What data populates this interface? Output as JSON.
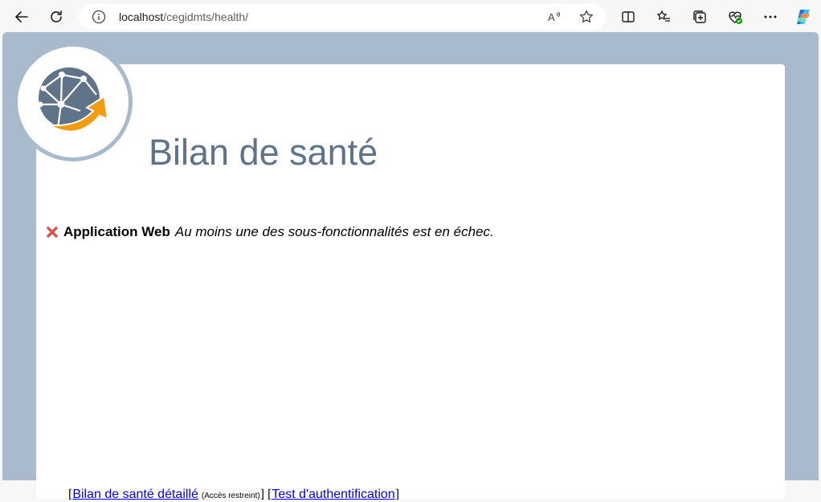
{
  "browser": {
    "url_host": "localhost",
    "url_path": "/cegidmts/health/"
  },
  "page": {
    "title": "Bilan de santé",
    "status": {
      "app_name": "Application Web",
      "message": "Au moins une des sous-fonctionnalités est en échec.",
      "state_color": "#d9534f"
    },
    "footer": {
      "open_bracket_1": "[",
      "link_detailed": "Bilan de santé détaillé",
      "restricted_note": "(Accès restreint)",
      "close_bracket_1": "]",
      "open_bracket_2": "[",
      "link_auth": "Test d'authentification",
      "close_bracket_2": "]"
    }
  },
  "colors": {
    "frame": "#a8bacc",
    "title": "#5f7489",
    "logo_globe": "#5f7489",
    "logo_arrow": "#f39c12"
  }
}
